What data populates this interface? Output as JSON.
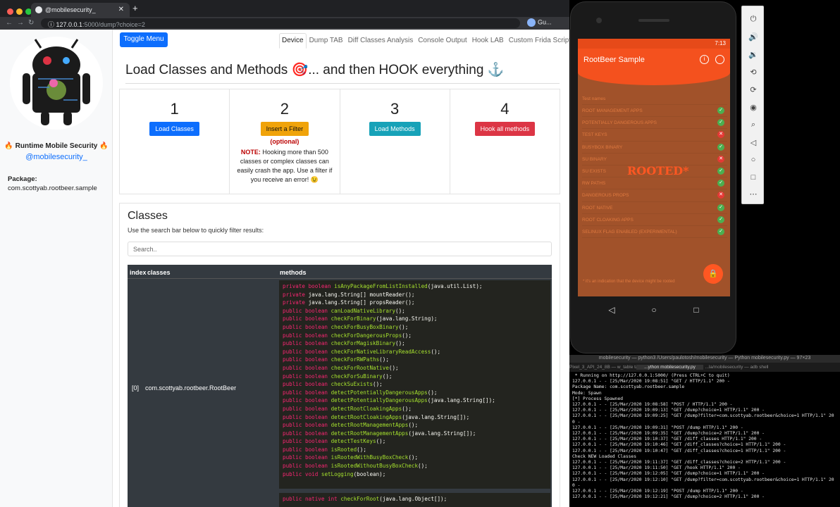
{
  "browser": {
    "tab_title": "@mobilesecurity_",
    "url_host": "127.0.0.1",
    "url_rest": ":5000/dump?choice=2",
    "profile": "Gu..."
  },
  "sidebar": {
    "title": "🔥 Runtime Mobile Security 🔥",
    "handle": "@mobilesecurity_",
    "package_label": "Package:",
    "package_name": "com.scottyab.rootbeer.sample"
  },
  "toolbar": {
    "toggle_label": "Toggle Menu",
    "nav": [
      "Device",
      "Dump TAB",
      "Diff Classes Analysis",
      "Console Output",
      "Hook LAB",
      "Custom Frida Script"
    ]
  },
  "main": {
    "heading": "Load Classes and Methods 🎯... and then HOOK everything ⚓",
    "steps": [
      {
        "num": "1",
        "label": "Load Classes",
        "color": "#0d6efd"
      },
      {
        "num": "2",
        "label": "Insert a Filter",
        "color": "#f0a30a"
      },
      {
        "num": "3",
        "label": "Load Methods",
        "color": "#17a2b8"
      },
      {
        "num": "4",
        "label": "Hook all methods",
        "color": "#dc3545"
      }
    ],
    "optional": "(optional)",
    "note_label": "NOTE:",
    "note_text": " Hooking more than 500 classes or complex classes can easily crash the app. Use a filter if you receive an error! 😉",
    "classes_title": "Classes",
    "classes_sub": "Use the search bar below to quickly filter results:",
    "search_placeholder": "Search..",
    "table_headers": [
      "index",
      "classes",
      "methods"
    ],
    "row_index": "[0]",
    "row_class": "com.scottyab.rootbeer.RootBeer",
    "methods": [
      [
        "private boolean",
        "isAnyPackageFromListInstalled",
        "(java.util.List);"
      ],
      [
        "private",
        "java.lang.String[] mountReader",
        "();"
      ],
      [
        "private",
        "java.lang.String[] propsReader",
        "();"
      ],
      [
        "public boolean",
        "canLoadNativeLibrary",
        "();"
      ],
      [
        "public boolean",
        "checkForBinary",
        "(java.lang.String);"
      ],
      [
        "public boolean",
        "checkForBusyBoxBinary",
        "();"
      ],
      [
        "public boolean",
        "checkForDangerousProps",
        "();"
      ],
      [
        "public boolean",
        "checkForMagiskBinary",
        "();"
      ],
      [
        "public boolean",
        "checkForNativeLibraryReadAccess",
        "();"
      ],
      [
        "public boolean",
        "checkForRWPaths",
        "();"
      ],
      [
        "public boolean",
        "checkForRootNative",
        "();"
      ],
      [
        "public boolean",
        "checkForSuBinary",
        "();"
      ],
      [
        "public boolean",
        "checkSuExists",
        "();"
      ],
      [
        "public boolean",
        "detectPotentiallyDangerousApps",
        "();"
      ],
      [
        "public boolean",
        "detectPotentiallyDangerousApps",
        "(java.lang.String[]);"
      ],
      [
        "public boolean",
        "detectRootCloakingApps",
        "();"
      ],
      [
        "public boolean",
        "detectRootCloakingApps",
        "(java.lang.String[]);"
      ],
      [
        "public boolean",
        "detectRootManagementApps",
        "();"
      ],
      [
        "public boolean",
        "detectRootManagementApps",
        "(java.lang.String[]);"
      ],
      [
        "public boolean",
        "detectTestKeys",
        "();"
      ],
      [
        "public boolean",
        "isRooted",
        "();"
      ],
      [
        "public boolean",
        "isRootedWithBusyBoxCheck",
        "();"
      ],
      [
        "public boolean",
        "isRootedWithoutBusyBoxCheck",
        "();"
      ],
      [
        "public void",
        "setLogging",
        "(boolean);"
      ]
    ],
    "next_method": [
      "public native int",
      "checkForRoot",
      "(java.lang.Object[]);"
    ]
  },
  "phone": {
    "time": "7:13",
    "app_title": "RootBeer Sample",
    "list_header": "Test names",
    "tests": [
      {
        "name": "ROOT MANAGEMENT APPS",
        "pass": true
      },
      {
        "name": "POTENTIALLY DANGEROUS APPS",
        "pass": true
      },
      {
        "name": "TEST KEYS",
        "pass": false
      },
      {
        "name": "BUSYBOX BINARY",
        "pass": true
      },
      {
        "name": "SU BINARY",
        "pass": false
      },
      {
        "name": "SU EXISTS",
        "pass": true
      },
      {
        "name": "RW PATHS",
        "pass": true
      },
      {
        "name": "DANGEROUS PROPS",
        "pass": false
      },
      {
        "name": "ROOT NATIVE",
        "pass": true
      },
      {
        "name": "ROOT CLOAKING APPS",
        "pass": true
      },
      {
        "name": "SELINUX FLAG ENABLED (EXPERIMENTAL)",
        "pass": true
      }
    ],
    "rooted_label": "ROOTED*",
    "footnote": "* it's an indication that the device might be rooted",
    "pass_color": "#4caf50",
    "fail_color": "#e53935"
  },
  "terminal": {
    "title": "mobilesecurity — python3 /Users/paulotosh/mobilesecurity — Python mobilesecurity.py — 97×23",
    "tabs": [
      "Pixel_3_API_24_8B — w_table tanner",
      "...ython mobilesecurity.py",
      "...la/mobilesecurity — adb shell"
    ],
    "lines": [
      " * Running on http://127.0.0.1:5000/ (Press CTRL+C to quit)",
      "127.0.0.1 - - [25/Mar/2020 19:08:51] \"GET / HTTP/1.1\" 200 -",
      "Package Name: com.scottyab.rootbeer.sample",
      "Mode: Spawn",
      "[*] Process Spawned",
      "127.0.0.1 - - [25/Mar/2020 19:08:58] \"POST / HTTP/1.1\" 200 -",
      "127.0.0.1 - - [25/Mar/2020 19:09:13] \"GET /dump?choice=1 HTTP/1.1\" 200 -",
      "127.0.0.1 - - [25/Mar/2020 19:09:25] \"GET /dump?filter=com.scottyab.rootbeer&choice=1 HTTP/1.1\" 20",
      "0 -",
      "127.0.0.1 - - [25/Mar/2020 19:09:31] \"POST /dump HTTP/1.1\" 200 -",
      "127.0.0.1 - - [25/Mar/2020 19:09:35] \"GET /dump?choice=2 HTTP/1.1\" 200 -",
      "127.0.0.1 - - [25/Mar/2020 19:10:37] \"GET /diff_classes HTTP/1.1\" 200 -",
      "127.0.0.1 - - [25/Mar/2020 19:10:46] \"GET /diff_classes?choice=1 HTTP/1.1\" 200 -",
      "127.0.0.1 - - [25/Mar/2020 19:10:47] \"GET /diff_classes?choice=1 HTTP/1.1\" 200 -",
      "Check NEW Loaded Classes",
      "127.0.0.1 - - [25/Mar/2020 19:11:37] \"GET /diff_classes?choice=2 HTTP/1.1\" 200 -",
      "127.0.0.1 - - [25/Mar/2020 19:11:50] \"GET /hook HTTP/1.1\" 200 -",
      "127.0.0.1 - - [25/Mar/2020 19:12:05] \"GET /dump?choice=1 HTTP/1.1\" 200 -",
      "127.0.0.1 - - [25/Mar/2020 19:12:10] \"GET /dump?filter=com.scottyab.rootbeer&choice=1 HTTP/1.1\" 20",
      "0 -",
      "127.0.0.1 - - [25/Mar/2020 19:12:19] \"POST /dump HTTP/1.1\" 200 -",
      "127.0.0.1 - - [25/Mar/2020 19:12:21] \"GET /dump?choice=2 HTTP/1.1\" 200 -"
    ]
  }
}
